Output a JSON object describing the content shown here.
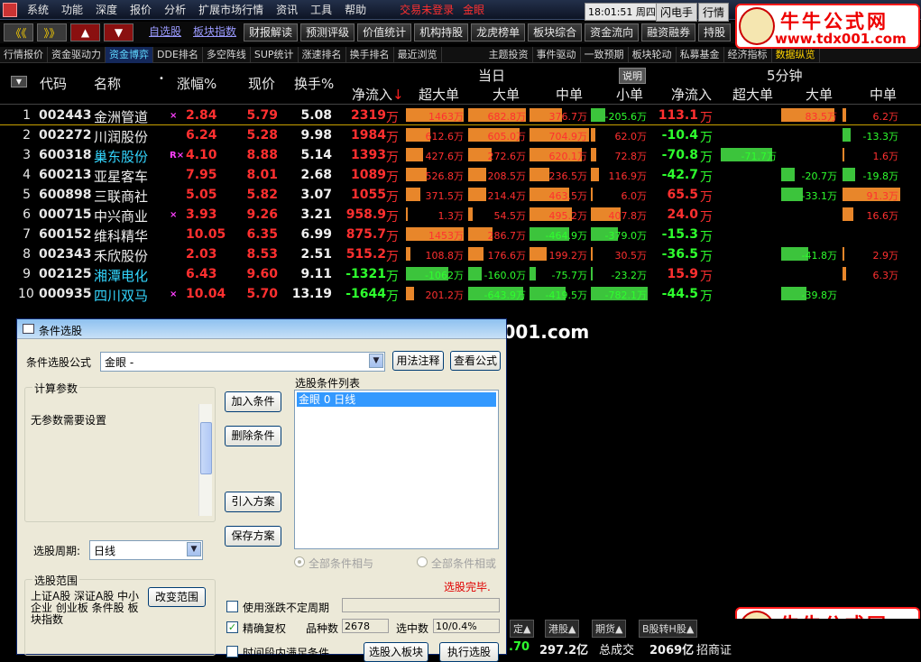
{
  "menu": {
    "items": [
      "系统",
      "功能",
      "深度",
      "报价",
      "分析",
      "扩展市场行情",
      "资讯",
      "工具",
      "帮助"
    ],
    "login_status": "交易未登录",
    "formula": "金眼",
    "clock": "18:01:51 周四",
    "flash_btn": "闪电手",
    "quote_btn": "行情"
  },
  "toolbar": {
    "nav": [
      "《《",
      "》》",
      "▲",
      "▼"
    ],
    "buttons": [
      "自选股",
      "板块指数",
      "财报解读",
      "预测评级",
      "价值统计",
      "机构持股",
      "龙虎榜单",
      "板块综合",
      "资金流向",
      "融资融券",
      "持股"
    ]
  },
  "tabs": [
    "行情报价",
    "资金驱动力",
    "资金博弈",
    "DDE排名",
    "多空阵线",
    "SUP统计",
    "涨速排名",
    "换手排名",
    "最近浏览",
    "主题投资",
    "事件驱动",
    "一致预期",
    "板块轮动",
    "私募基金",
    "经济指标",
    "数据纵览"
  ],
  "columns": {
    "code": "代码",
    "name": "名称",
    "dot": "•",
    "change": "涨幅%",
    "price": "现价",
    "turnover": "换手%",
    "today": "当日",
    "explain": "说明",
    "five_min": "5分钟",
    "net_inflow": "净流入",
    "super_large": "超大单",
    "large": "大单",
    "medium": "中单",
    "small": "小单"
  },
  "unit": "万",
  "colors": {
    "red": "#ff3030",
    "green": "#2eff2e",
    "bar_orange": "#e8862a",
    "bar_green": "#3cc43c",
    "name_cyan": "#33d6ff"
  },
  "rows": [
    {
      "idx": "1",
      "code": "002443",
      "name": "金洲管道",
      "flag": "×",
      "change": "2.84",
      "price": "5.79",
      "turnover": "5.08",
      "net": "2319",
      "super": "1463万",
      "large": "682.8万",
      "medium": "376.7万",
      "small": "-205.6万",
      "net5": "113.1",
      "super5": "",
      "large5": "83.5万",
      "medium5": "6.2万",
      "name_color": "white"
    },
    {
      "idx": "2",
      "code": "002272",
      "name": "川润股份",
      "flag": "",
      "change": "6.24",
      "price": "5.28",
      "turnover": "9.98",
      "net": "1984",
      "super": "612.6万",
      "large": "605.0万",
      "medium": "704.9万",
      "small": "62.0万",
      "net5": "-10.4",
      "super5": "",
      "large5": "",
      "medium5": "-13.3万",
      "name_color": "white"
    },
    {
      "idx": "3",
      "code": "600318",
      "name": "巢东股份",
      "flag": "R×",
      "change": "4.10",
      "price": "8.88",
      "turnover": "5.14",
      "net": "1393",
      "super": "427.6万",
      "large": "272.6万",
      "medium": "620.1万",
      "small": "72.8万",
      "net5": "-70.8",
      "super5": "-71.7万",
      "large5": "",
      "medium5": "1.6万",
      "name_color": "cyan"
    },
    {
      "idx": "4",
      "code": "600213",
      "name": "亚星客车",
      "flag": "",
      "change": "7.95",
      "price": "8.01",
      "turnover": "2.68",
      "net": "1089",
      "super": "526.8万",
      "large": "208.5万",
      "medium": "236.5万",
      "small": "116.9万",
      "net5": "-42.7",
      "super5": "",
      "large5": "-20.7万",
      "medium5": "-19.8万",
      "name_color": "white"
    },
    {
      "idx": "5",
      "code": "600898",
      "name": "三联商社",
      "flag": "",
      "change": "5.05",
      "price": "5.82",
      "turnover": "3.07",
      "net": "1055",
      "super": "371.5万",
      "large": "214.4万",
      "medium": "463.5万",
      "small": "6.0万",
      "net5": "65.5",
      "super5": "",
      "large5": "-33.1万",
      "medium5": "91.3万",
      "name_color": "white"
    },
    {
      "idx": "6",
      "code": "000715",
      "name": "中兴商业",
      "flag": "×",
      "change": "3.93",
      "price": "9.26",
      "turnover": "3.21",
      "net": "958.9",
      "super": "1.3万",
      "large": "54.5万",
      "medium": "495.2万",
      "small": "407.8万",
      "net5": "24.0",
      "super5": "",
      "large5": "",
      "medium5": "16.6万",
      "name_color": "white"
    },
    {
      "idx": "7",
      "code": "600152",
      "name": "维科精华",
      "flag": "",
      "change": "10.05",
      "price": "6.35",
      "turnover": "6.99",
      "net": "875.7",
      "super": "1453万",
      "large": "286.7万",
      "medium": "-464.9万",
      "small": "-379.0万",
      "net5": "-15.3",
      "super5": "",
      "large5": "",
      "medium5": "",
      "name_color": "white"
    },
    {
      "idx": "8",
      "code": "002343",
      "name": "禾欣股份",
      "flag": "",
      "change": "2.03",
      "price": "8.53",
      "turnover": "2.51",
      "net": "515.2",
      "super": "108.8万",
      "large": "176.6万",
      "medium": "199.2万",
      "small": "30.5万",
      "net5": "-36.5",
      "super5": "",
      "large5": "-41.8万",
      "medium5": "2.9万",
      "name_color": "white"
    },
    {
      "idx": "9",
      "code": "002125",
      "name": "湘潭电化",
      "flag": "",
      "change": "6.43",
      "price": "9.60",
      "turnover": "9.11",
      "net": "-1321",
      "super": "-1062万",
      "large": "-160.0万",
      "medium": "-75.7万",
      "small": "-23.2万",
      "net5": "15.9",
      "super5": "",
      "large5": "",
      "medium5": "6.3万",
      "name_color": "cyan"
    },
    {
      "idx": "10",
      "code": "000935",
      "name": "四川双马",
      "flag": "×",
      "change": "10.04",
      "price": "5.70",
      "turnover": "13.19",
      "net": "-1644",
      "super": "201.2万",
      "large": "-643.9万",
      "medium": "-419.5万",
      "small": "-782.1万",
      "net5": "-44.5",
      "super5": "",
      "large5": "-39.8万",
      "medium5": "",
      "name_color": "cyan"
    }
  ],
  "watermark": {
    "center": "牛牛公式网 www.tdx001.com",
    "logo_title": "牛牛公式网",
    "logo_url": "www.tdx001.com"
  },
  "dialog": {
    "title": "条件选股",
    "formula_label": "条件选股公式",
    "formula_value": "金眼        -",
    "usage_btn": "用法注释",
    "view_btn": "查看公式",
    "params_title": "计算参数",
    "params_text": "无参数需要设置",
    "add_btn": "加入条件",
    "delete_btn": "删除条件",
    "import_btn": "引入方案",
    "save_btn": "保存方案",
    "cond_list_title": "选股条件列表",
    "cond_item": "金眼  0  日线",
    "all_and": "全部条件相与",
    "all_or": "全部条件相或",
    "done": "选股完毕.",
    "period_label": "选股周期:",
    "period_value": "日线",
    "scope_title": "选股范围",
    "scope_text": "上证A股 深证A股 中小企业 创业板 条件股 板块指数",
    "change_scope_btn": "改变范围",
    "chk_uncertain": "使用涨跌不定周期",
    "chk_adjust": "精确复权",
    "chk_time": "时间段内满足条件",
    "count_label": "品种数",
    "count_value": "2678",
    "hit_label": "选中数",
    "hit_value": "10/0.4%",
    "to_block_btn": "选股入板块",
    "exec_btn": "执行选股"
  },
  "statusbar": {
    "tabs": [
      "定▲",
      "港股▲",
      "期货▲",
      "B股转H股▲"
    ],
    "val1": ".70",
    "val2": "297.2亿",
    "label3": "总成交",
    "val3": "2069亿",
    "label4": "招商证"
  }
}
